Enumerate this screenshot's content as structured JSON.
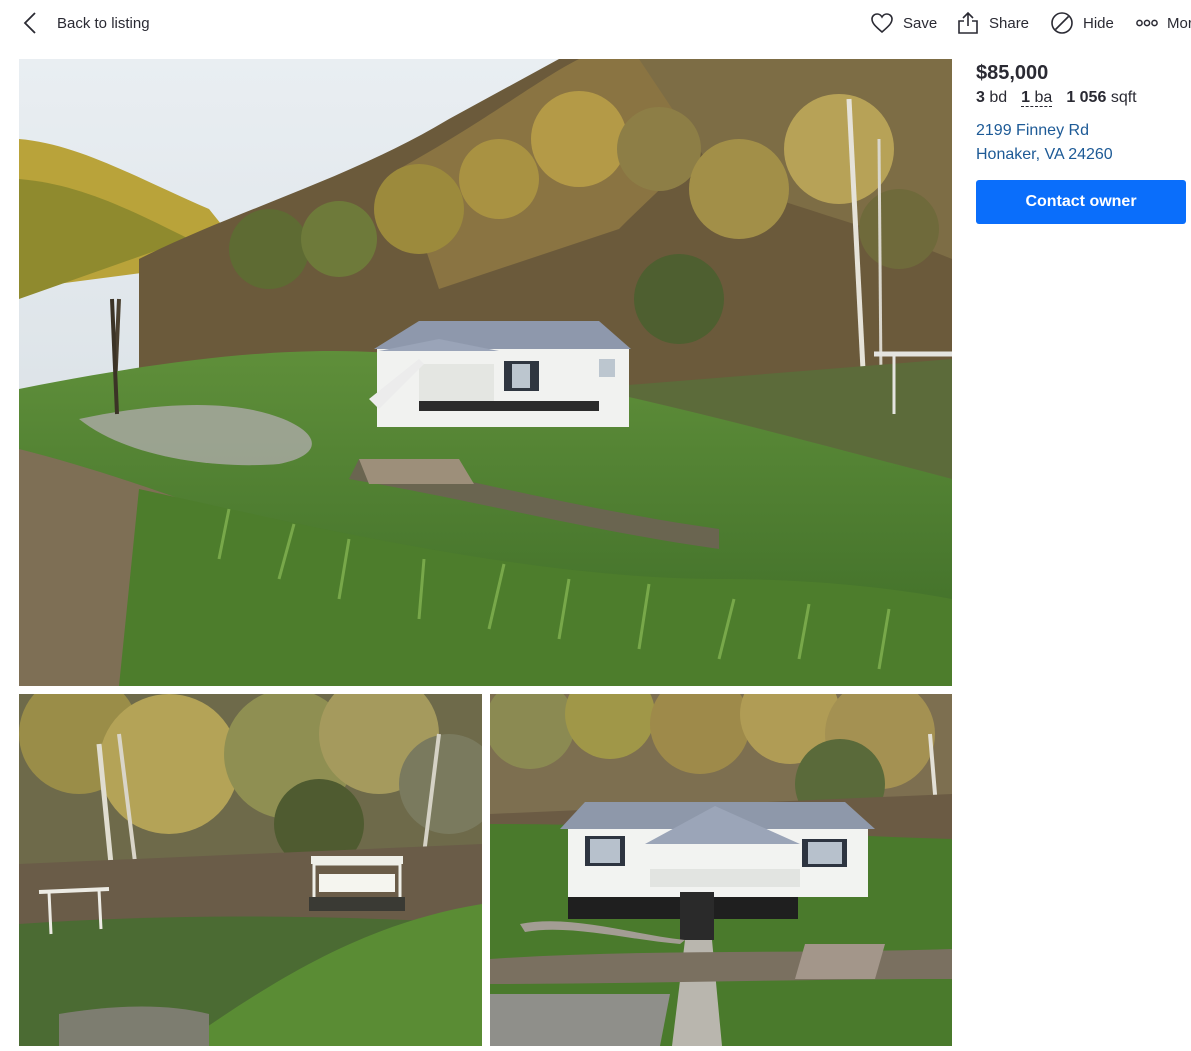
{
  "nav": {
    "back_label": "Back to listing",
    "save_label": "Save",
    "share_label": "Share",
    "hide_label": "Hide",
    "more_label": "More"
  },
  "listing": {
    "price": "$85,000",
    "beds_value": "3",
    "beds_unit": "bd",
    "baths_value": "1",
    "baths_unit": "ba",
    "sqft_value": "1 056",
    "sqft_unit": "sqft",
    "address_line1": "2199 Finney Rd",
    "address_line2": "Honaker, VA 24260",
    "contact_label": "Contact owner"
  },
  "photos": [
    {
      "icon": "photo-main-house-hillside"
    },
    {
      "icon": "photo-gazebo-woods"
    },
    {
      "icon": "photo-house-front-walkway"
    }
  ],
  "colors": {
    "accent": "#0a6efb",
    "link": "#1d5a96",
    "text": "#2a2a33"
  }
}
